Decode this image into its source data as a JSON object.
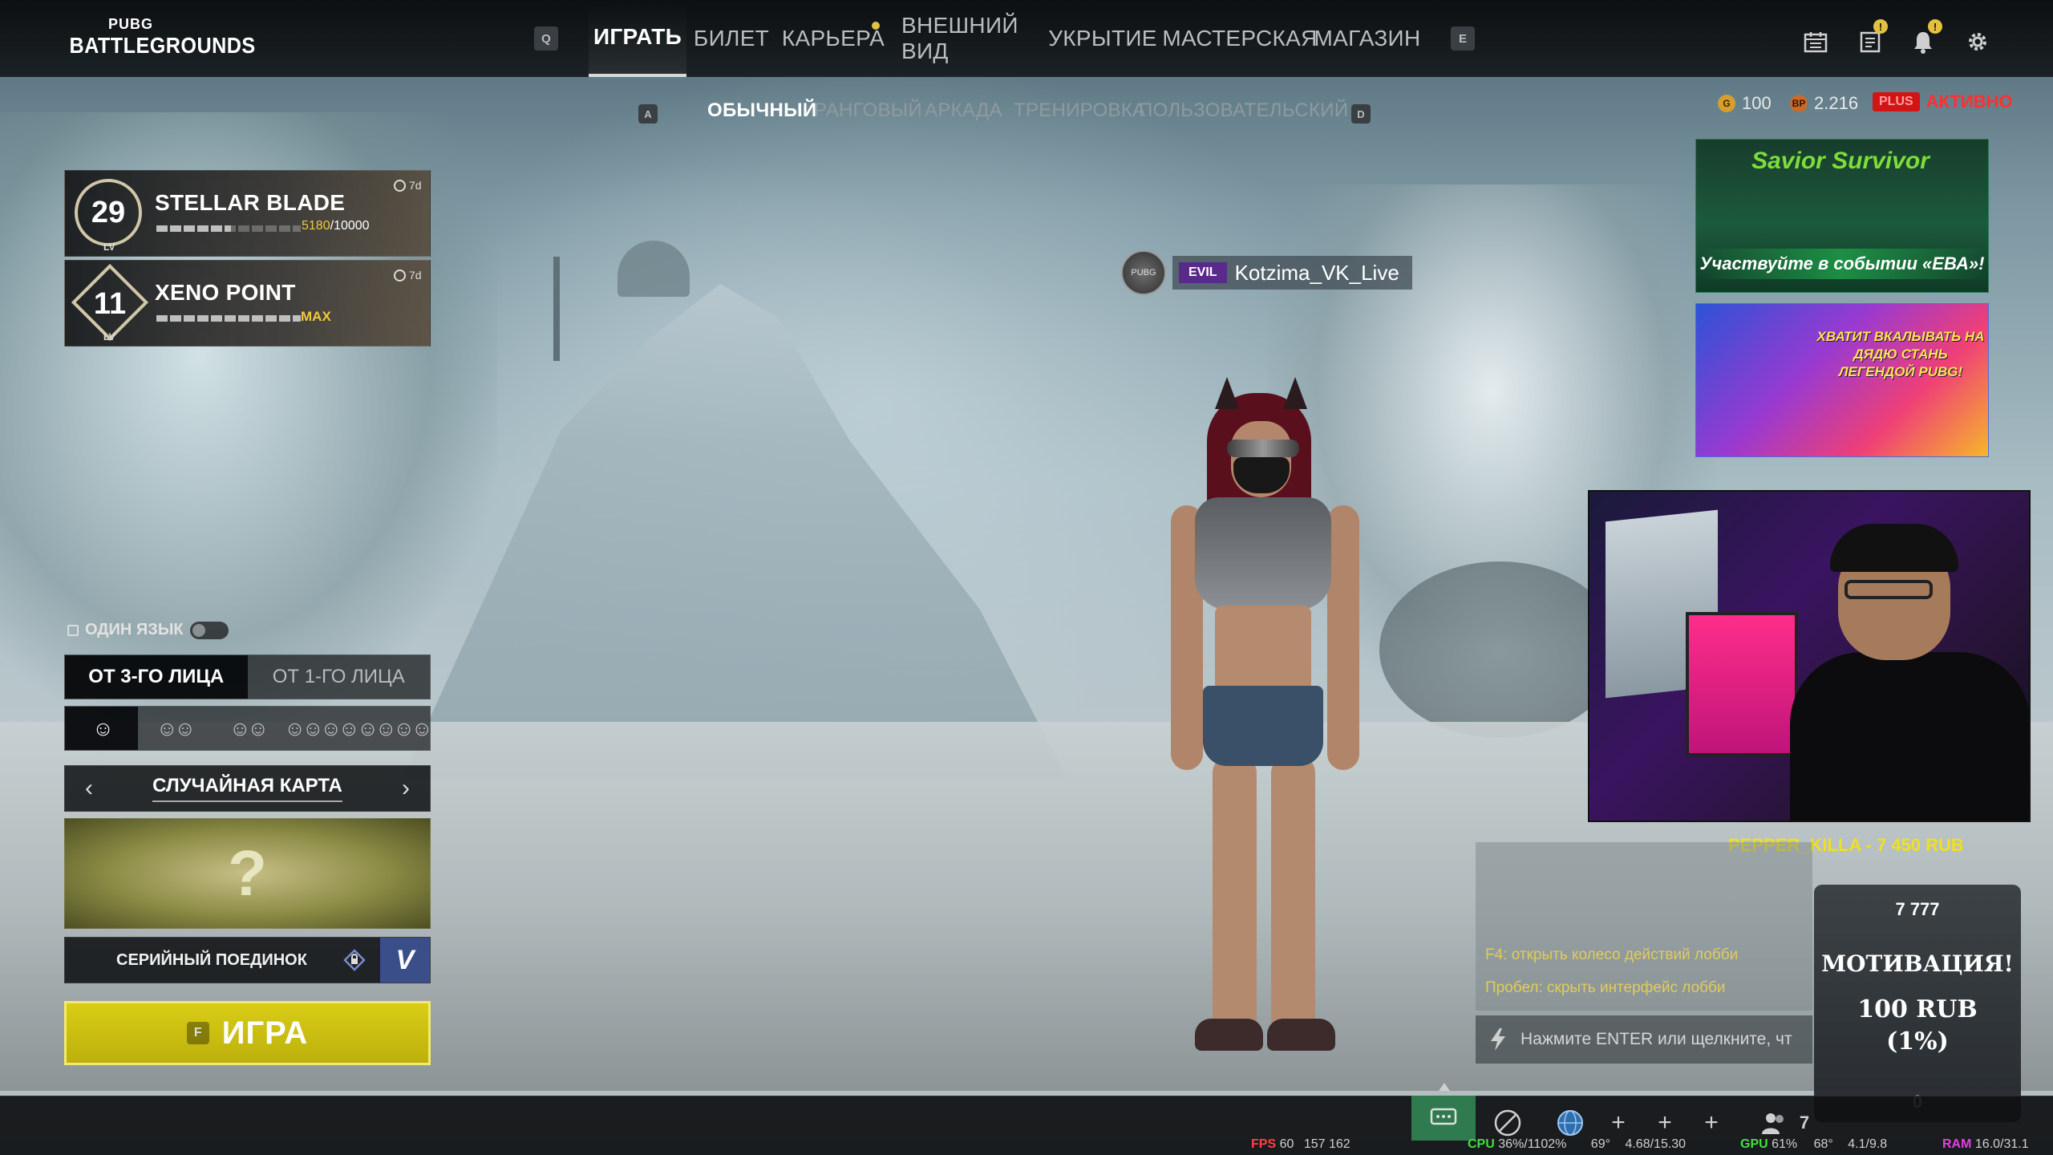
{
  "app": {
    "logo_top": "PUBG",
    "logo_main": "BATTLEGROUNDS"
  },
  "nav": {
    "key_left": "Q",
    "key_right": "E",
    "tabs": [
      {
        "label": "ИГРАТЬ",
        "active": true
      },
      {
        "label": "БИЛЕТ"
      },
      {
        "label": "КАРЬЕРА",
        "has_notification": true
      },
      {
        "label": "ВНЕШНИЙ ВИД"
      },
      {
        "label": "УКРЫТИЕ"
      },
      {
        "label": "МАСТЕРСКАЯ"
      },
      {
        "label": "МАГАЗИН"
      }
    ]
  },
  "modes": {
    "key_left": "A",
    "key_right": "D",
    "tabs": [
      {
        "label": "ОБЫЧНЫЙ",
        "active": true
      },
      {
        "label": "РАНГОВЫЙ"
      },
      {
        "label": "АРКАДА"
      },
      {
        "label": "ТРЕНИРОВКА"
      },
      {
        "label": "ПОЛЬЗОВАТЕЛЬСКИЙ"
      }
    ]
  },
  "top_icons": [
    "calendar-icon",
    "news-icon",
    "bell-icon",
    "gear-icon"
  ],
  "currencies": {
    "g_coin_symbol": "G",
    "g_coin": "100",
    "bp_symbol": "BP",
    "bp": "2.216",
    "status_chip": "PLUS",
    "status_text": "АКТИВНО"
  },
  "passes": [
    {
      "level": "29",
      "level_sub": "LV",
      "title": "STELLAR BLADE",
      "progress_current": "5180",
      "progress_rest": "/10000",
      "progress_fraction": 0.518,
      "time": "7d"
    },
    {
      "level": "11",
      "level_sub": "LV",
      "title": "XENO POINT",
      "progress_label": "MAX",
      "progress_fraction": 1.0,
      "time": "7d"
    }
  ],
  "lobby": {
    "one_language_label": "ОДИН ЯЗЫК",
    "perspective": [
      {
        "label": "ОТ 3-ГО ЛИЦА",
        "active": true
      },
      {
        "label": "ОТ 1-ГО ЛИЦА"
      }
    ],
    "squad_sizes": [
      {
        "glyph": "☺",
        "active": true
      },
      {
        "glyph": "☺☺"
      },
      {
        "glyph": "☺☺"
      },
      {
        "glyph": "☺☺☺☺"
      },
      {
        "glyph": "☺☺☺☺"
      }
    ],
    "map_label": "СЛУЧАЙНАЯ КАРТА",
    "map_placeholder": "?",
    "ranked_label": "СЕРИЙНЫЙ ПОЕДИНОК",
    "ranked_mark": "V",
    "play_key": "F",
    "play_label": "ИГРА"
  },
  "player": {
    "emblem_label": "PUBG",
    "tag": "EVIL",
    "name": "Kotzima_VK_Live"
  },
  "banners": {
    "event_logo": "Savior Survivor",
    "event_cta": "Участвуйте в событии «ЕВА»!",
    "promo_text": "ХВАТИТ ВКАЛЫВАТЬ НА ДЯДЮ СТАНЬ ЛЕГЕНДОЙ PUBG!"
  },
  "stream": {
    "donor_line": "PEPPER_KILLA - 7 450 RUB",
    "hints": [
      "F4: открыть колесо действий лобби",
      "Пробел: скрыть интерфейс лобби"
    ],
    "chat_placeholder": "Нажмите ENTER или щелкните, чт",
    "motivation": {
      "goal": "7 777",
      "title": "МОТИВАЦИЯ!",
      "amount_line1": "100 RUB",
      "amount_line2": "(1%)",
      "current": "0"
    }
  },
  "bottom": {
    "friends_count": "7",
    "stats": {
      "fps_label": "FPS",
      "fps_value": "60",
      "fps_extra": "157 162",
      "cpu_label": "CPU",
      "cpu_value": "36%/1102%",
      "cpu_temp": "69°",
      "mem_value": "4.68/15.30",
      "gpu_label": "GPU",
      "gpu_value": "61%",
      "gpu_temp": "68°",
      "vram_value": "4.1/9.8",
      "ram_label": "RAM",
      "ram_value": "16.0/31.1"
    }
  },
  "colors": {
    "accent_play": "#d9cd16",
    "active_red": "#ff3030",
    "hint_yellow": "#e0cc5a",
    "donor_yellow": "#f0e020"
  }
}
